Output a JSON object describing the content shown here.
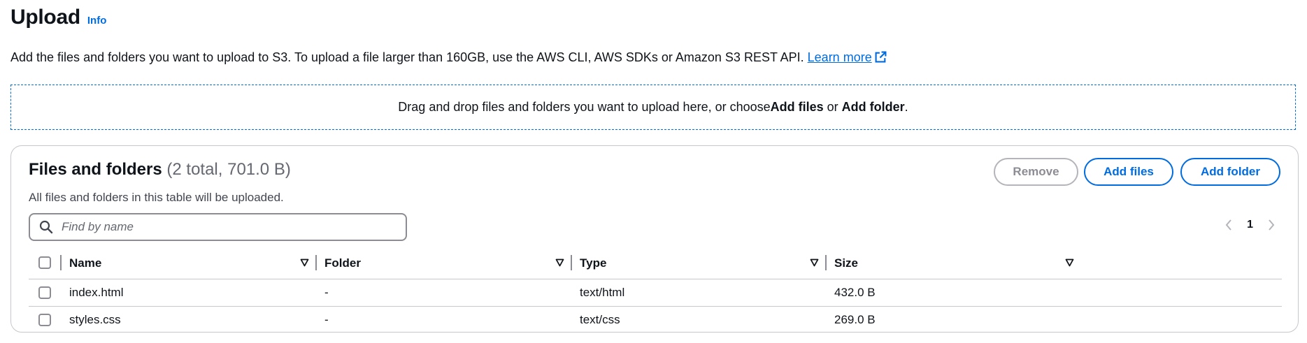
{
  "header": {
    "title": "Upload",
    "info_label": "Info"
  },
  "description": {
    "text": "Add the files and folders you want to upload to S3. To upload a file larger than 160GB, use the AWS CLI, AWS SDKs or Amazon S3 REST API. ",
    "learn_more_label": "Learn more"
  },
  "dropzone": {
    "text_before": "Drag and drop files and folders you want to upload here, or choose ",
    "add_files": "Add files",
    "or": " or ",
    "add_folder": "Add folder",
    "text_after": "."
  },
  "panel": {
    "title": "Files and folders",
    "count": "(2 total, 701.0 B)",
    "subtitle": "All files and folders in this table will be uploaded.",
    "buttons": {
      "remove": "Remove",
      "add_files": "Add files",
      "add_folder": "Add folder"
    },
    "search": {
      "placeholder": "Find by name",
      "value": ""
    },
    "pagination": {
      "current_page": "1"
    },
    "table": {
      "columns": [
        "Name",
        "Folder",
        "Type",
        "Size"
      ],
      "rows": [
        {
          "name": "index.html",
          "folder": "-",
          "type": "text/html",
          "size": "432.0 B"
        },
        {
          "name": "styles.css",
          "folder": "-",
          "type": "text/css",
          "size": "269.0 B"
        }
      ]
    }
  },
  "colors": {
    "accent": "#006ce0",
    "text": "#0f141a",
    "muted": "#656871",
    "border": "#c6c6cd",
    "disabled": "#8c8c94"
  },
  "icons": [
    "external-link-icon",
    "search-icon",
    "chevron-left-icon",
    "chevron-right-icon",
    "sort-down-icon"
  ]
}
